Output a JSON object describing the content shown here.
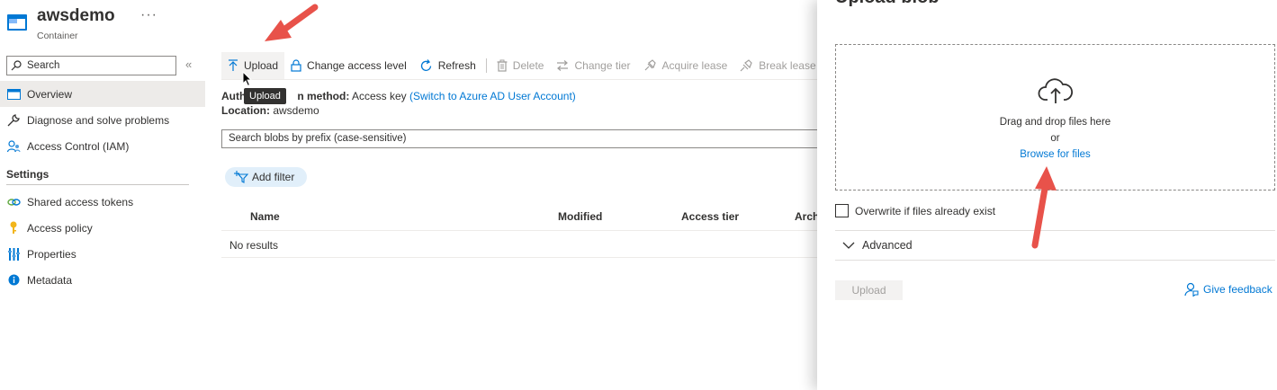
{
  "blade": {
    "title": "awsdemo",
    "more": "···",
    "subtitle": "Container",
    "search_placeholder": "Search",
    "collapse": "«"
  },
  "nav": {
    "overview": "Overview",
    "diagnose": "Diagnose and solve problems",
    "access_control": "Access Control (IAM)",
    "settings_header": "Settings",
    "shared_tokens": "Shared access tokens",
    "access_policy": "Access policy",
    "properties": "Properties",
    "metadata": "Metadata"
  },
  "toolbar": {
    "upload": "Upload",
    "change_access": "Change access level",
    "refresh": "Refresh",
    "delete": "Delete",
    "change_tier": "Change tier",
    "acquire_lease": "Acquire lease",
    "break_lease": "Break lease"
  },
  "tooltip": "Upload",
  "auth": {
    "label_left": "Auth",
    "label_right": "n method:",
    "value": "Access key",
    "link": "(Switch to Azure AD User Account)"
  },
  "location": {
    "label": "Location:",
    "value": "awsdemo"
  },
  "blob_search_placeholder": "Search blobs by prefix (case-sensitive)",
  "add_filter": "Add filter",
  "table": {
    "columns": [
      "Name",
      "Modified",
      "Access tier",
      "Archi"
    ],
    "empty": "No results"
  },
  "panel": {
    "title": "Upload blob",
    "drop_text": "Drag and drop files here",
    "or": "or",
    "browse": "Browse for files",
    "overwrite": "Overwrite if files already exist",
    "advanced": "Advanced",
    "upload_button": "Upload",
    "feedback": "Give feedback"
  },
  "colors": {
    "accent": "#0078d4",
    "annotation_arrow": "#e8524a"
  }
}
